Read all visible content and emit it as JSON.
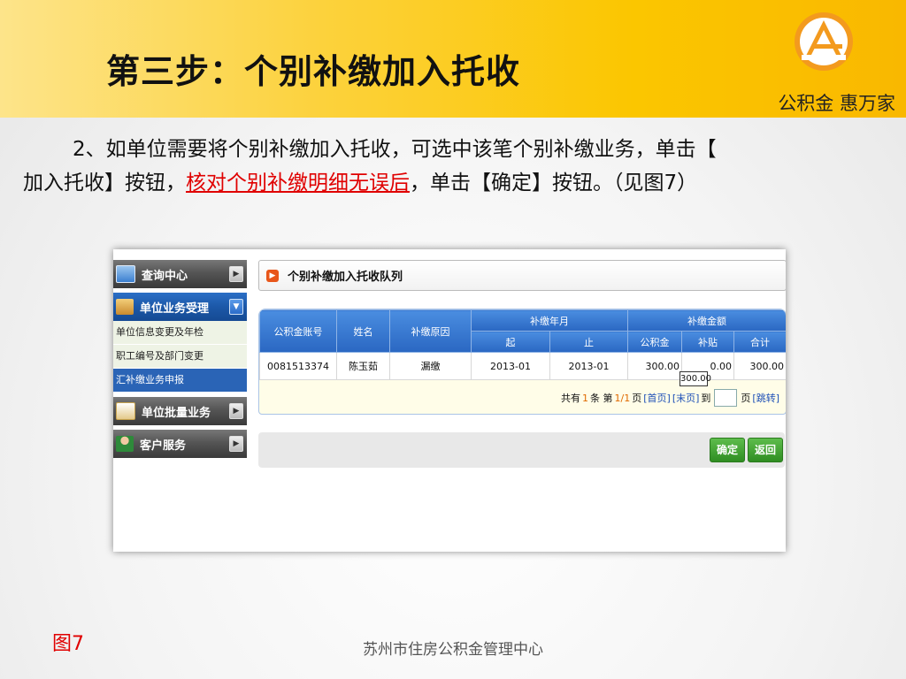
{
  "slide": {
    "title": "第三步：个别补缴加入托收",
    "slogan": "公积金  惠万家",
    "para_line1": "2、如单位需要将个别补缴加入托收，可选中该笔个别补缴业务，单击【",
    "para_line2_a": "加入托收】按钮，",
    "para_line2_highlight": "核对个别补缴明细无误后",
    "para_line2_b": "，单击【确定】按钮。（见图7）",
    "figure_label": "图7",
    "footer": "苏州市住房公积金管理中心",
    "colors": {
      "banner": "#fbc600",
      "highlight": "#e00000",
      "logo": "#f39a1e"
    }
  },
  "app": {
    "sidebar": {
      "items": [
        {
          "label": "查询中心",
          "icon": "monitor-icon"
        },
        {
          "label": "单位业务受理",
          "icon": "briefcase-icon"
        },
        {
          "label": "单位批量业务",
          "icon": "document-icon"
        },
        {
          "label": "客户服务",
          "icon": "person-icon"
        }
      ],
      "sub_items": [
        "单位信息变更及年检",
        "职工编号及部门变更",
        "汇补缴业务申报"
      ]
    },
    "panel_title": "个别补缴加入托收队列",
    "table": {
      "headers": {
        "account": "公积金账号",
        "name": "姓名",
        "reason": "补缴原因",
        "period": "补缴年月",
        "amount": "补缴金额",
        "from": "起",
        "to": "止",
        "fund": "公积金",
        "subsidy": "补贴",
        "total": "合计"
      },
      "rows": [
        {
          "account": "0081513374",
          "name": "陈玉茹",
          "reason": "漏缴",
          "from": "2013-01",
          "to": "2013-01",
          "fund": "300.00",
          "subsidy": "0.00",
          "total": "300.00"
        }
      ],
      "tooltip": "300.00"
    },
    "pager": {
      "p1": "共有",
      "count": "1",
      "p2": "条 第",
      "page": "1/1",
      "p3": "页",
      "first": "[首页]",
      "last": "[末页]",
      "to": "到",
      "page_suffix": "页",
      "jump": "[跳转]"
    },
    "buttons": {
      "confirm": "确定",
      "back": "返回"
    }
  }
}
